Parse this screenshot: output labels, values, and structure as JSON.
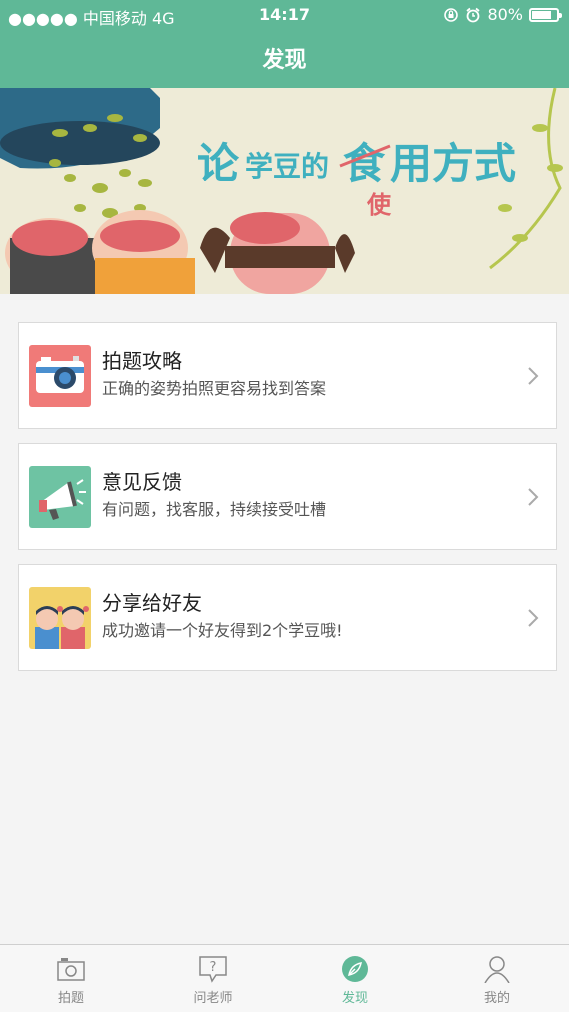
{
  "status_bar": {
    "carrier": "●●●●● 中国移动  4G",
    "time": "14:17",
    "battery": "80%",
    "battery_level": 0.8
  },
  "nav": {
    "title": "发现"
  },
  "banner": {
    "headline_prefix": "论",
    "headline_mid": "学豆的",
    "headline_struck": "食",
    "headline_suffix": "用方式",
    "headline_correction": "使",
    "slide_count": 3,
    "active_slide": 3
  },
  "cards": [
    {
      "title": "拍题攻略",
      "subtitle": "正确的姿势拍照更容易找到答案",
      "icon": "camera-icon",
      "color": "#f07a78"
    },
    {
      "title": "意见反馈",
      "subtitle": "有问题，找客服，持续接受吐槽",
      "icon": "megaphone-icon",
      "color": "#6ec3a3"
    },
    {
      "title": "分享给好友",
      "subtitle": "成功邀请一个好友得到2个学豆哦!",
      "icon": "friends-icon",
      "color": "#f2d26a"
    }
  ],
  "tabs": [
    {
      "label": "拍题",
      "icon": "camera-outline-icon",
      "active": false
    },
    {
      "label": "问老师",
      "icon": "question-bubble-icon",
      "active": false
    },
    {
      "label": "发现",
      "icon": "compass-icon",
      "active": true
    },
    {
      "label": "我的",
      "icon": "person-icon",
      "active": false
    }
  ],
  "colors": {
    "accent": "#5fb897",
    "banner_bg": "#eeebd7",
    "text_main": "#222222",
    "text_sub": "#555555"
  }
}
